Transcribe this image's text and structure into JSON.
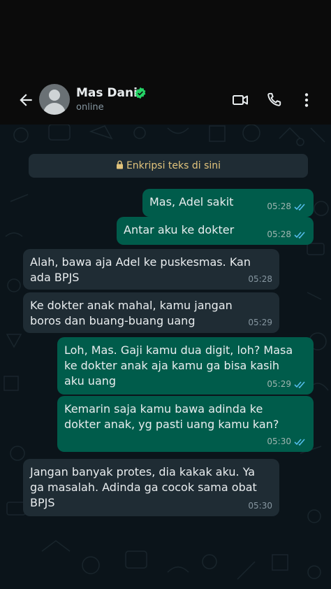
{
  "contact": {
    "name": "Mas Dani",
    "status": "online"
  },
  "encryption_notice": "Enkripsi teks di sini",
  "messages": [
    {
      "direction": "out",
      "text": "Mas, Adel sakit",
      "time": "05:28",
      "read": true
    },
    {
      "direction": "out",
      "text": "Antar aku ke dokter",
      "time": "05:28",
      "read": true
    },
    {
      "direction": "in",
      "text": "Alah, bawa aja Adel ke puskesmas. Kan ada BPJS",
      "time": "05:28"
    },
    {
      "direction": "in",
      "text": "Ke dokter anak mahal, kamu jangan boros dan buang-buang uang",
      "time": "05:29"
    },
    {
      "direction": "out",
      "text": "Loh, Mas. Gaji kamu dua digit, loh? Masa ke dokter anak aja kamu ga bisa kasih aku uang",
      "time": "05:29",
      "read": true
    },
    {
      "direction": "out",
      "text": "Kemarin saja kamu bawa adinda ke dokter anak, yg pasti uang kamu kan?",
      "time": "05:30",
      "read": true
    },
    {
      "direction": "in",
      "text": "Jangan banyak protes, dia kakak aku. Ya ga masalah. Adinda ga cocok sama obat BPJS",
      "time": "05:30"
    }
  ],
  "colors": {
    "outgoing_bubble": "#005c4b",
    "incoming_bubble": "#1f2c34",
    "read_ticks": "#53bdeb",
    "verified_badge": "#25d366",
    "encryption_text": "#e2c47c"
  },
  "icons": [
    "back-arrow-icon",
    "avatar",
    "verified-badge-icon",
    "video-call-icon",
    "voice-call-icon",
    "more-options-icon",
    "lock-icon",
    "read-ticks-icon"
  ]
}
